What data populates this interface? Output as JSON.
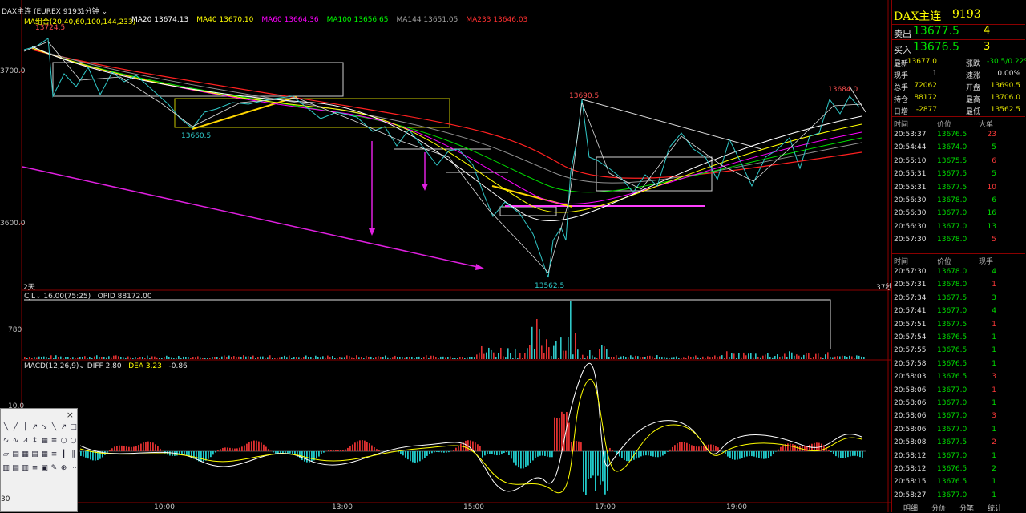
{
  "header": {
    "instrument": "DAX主连 (EUREX 9193)",
    "period": "1分钟",
    "ma_group": "MA组合(20,40,60,100,144,233)",
    "ma_values": [
      {
        "label": "MA20 13674.13",
        "color": "#ffffff"
      },
      {
        "label": "MA40 13670.10",
        "color": "#ffff00"
      },
      {
        "label": "MA60 13664.36",
        "color": "#ff00ff"
      },
      {
        "label": "MA100 13656.65",
        "color": "#00ff00"
      },
      {
        "label": "MA144 13651.05",
        "color": "#a0a0a0"
      },
      {
        "label": "MA233 13646.03",
        "color": "#ff3030"
      }
    ]
  },
  "price_axis": {
    "p13700": "3700.0",
    "p13600": "3600.0",
    "vol780": "780",
    "macd10": "10.0"
  },
  "annotations": {
    "high_start": "13724.5",
    "low1": "13660.5",
    "high_mid": "13690.5",
    "low_main": "13562.5",
    "high_end": "13684.0",
    "left_tag": "2天",
    "right_tag": "37秒"
  },
  "volume_header": {
    "name": "CJL",
    "value": "16.00(75:25)",
    "opid": "OPID 88172.00"
  },
  "macd_header": {
    "name": "MACD(12,26,9)",
    "diff": "DIFF 2.80",
    "dea": "DEA 3.23",
    "macd": "-0.86"
  },
  "time_axis": [
    "10:00",
    "13:00",
    "15:00",
    "17:00",
    "19:00"
  ],
  "quote": {
    "title": "DAX主连",
    "code": "9193",
    "sell_label": "卖出",
    "sell_price": "13677.5",
    "sell_vol": "4",
    "buy_label": "买入",
    "buy_price": "13676.5",
    "buy_vol": "3",
    "stats": [
      {
        "k1": "最新",
        "v1": "13677.0",
        "c1": "#e0e000",
        "k2": "涨跌",
        "v2": "-30.5/0.22%",
        "c2": "#00e000"
      },
      {
        "k1": "现手",
        "v1": "1",
        "c1": "#e0e0e0",
        "k2": "速涨",
        "v2": "0.00%",
        "c2": "#e0e0e0"
      },
      {
        "k1": "总手",
        "v1": "72062",
        "c1": "#e0e000",
        "k2": "开盘",
        "v2": "13690.5",
        "c2": "#e0e000"
      },
      {
        "k1": "持仓",
        "v1": "88172",
        "c1": "#e0e000",
        "k2": "最高",
        "v2": "13706.0",
        "c2": "#e0e000"
      },
      {
        "k1": "日增",
        "v1": "-2877",
        "c1": "#e0e000",
        "k2": "最低",
        "v2": "13562.5",
        "c2": "#e0e000"
      }
    ]
  },
  "ticks_big": {
    "headers": [
      "时间",
      "价位",
      "大单"
    ],
    "rows": [
      {
        "t": "20:53:37",
        "p": "13676.5",
        "v": "23",
        "vc": "#ff3a3a"
      },
      {
        "t": "20:54:44",
        "p": "13674.0",
        "v": "5",
        "vc": "#00e000"
      },
      {
        "t": "20:55:10",
        "p": "13675.5",
        "v": "6",
        "vc": "#ff3a3a"
      },
      {
        "t": "20:55:31",
        "p": "13677.5",
        "v": "5",
        "vc": "#00e000"
      },
      {
        "t": "20:55:31",
        "p": "13677.5",
        "v": "10",
        "vc": "#ff3a3a"
      },
      {
        "t": "20:56:30",
        "p": "13678.0",
        "v": "6",
        "vc": "#00e000"
      },
      {
        "t": "20:56:30",
        "p": "13677.0",
        "v": "16",
        "vc": "#00e000"
      },
      {
        "t": "20:56:30",
        "p": "13677.0",
        "v": "13",
        "vc": "#00e000"
      },
      {
        "t": "20:57:30",
        "p": "13678.0",
        "v": "5",
        "vc": "#ff3a3a"
      }
    ]
  },
  "ticks": {
    "headers": [
      "时间",
      "价位",
      "现手"
    ],
    "rows": [
      {
        "t": "20:57:30",
        "p": "13678.0",
        "v": "4",
        "vc": "#00e000"
      },
      {
        "t": "20:57:31",
        "p": "13678.0",
        "v": "1",
        "vc": "#ff3a3a"
      },
      {
        "t": "20:57:34",
        "p": "13677.5",
        "v": "3",
        "vc": "#00e000"
      },
      {
        "t": "20:57:41",
        "p": "13677.0",
        "v": "4",
        "vc": "#00e000"
      },
      {
        "t": "20:57:51",
        "p": "13677.5",
        "v": "1",
        "vc": "#ff3a3a"
      },
      {
        "t": "20:57:54",
        "p": "13676.5",
        "v": "1",
        "vc": "#00e000"
      },
      {
        "t": "20:57:55",
        "p": "13676.5",
        "v": "1",
        "vc": "#00e000"
      },
      {
        "t": "20:57:58",
        "p": "13676.5",
        "v": "1",
        "vc": "#00e000"
      },
      {
        "t": "20:58:03",
        "p": "13676.5",
        "v": "3",
        "vc": "#ff3a3a"
      },
      {
        "t": "20:58:06",
        "p": "13677.0",
        "v": "1",
        "vc": "#ff3a3a"
      },
      {
        "t": "20:58:06",
        "p": "13677.0",
        "v": "1",
        "vc": "#00e000"
      },
      {
        "t": "20:58:06",
        "p": "13677.0",
        "v": "3",
        "vc": "#ff3a3a"
      },
      {
        "t": "20:58:06",
        "p": "13677.0",
        "v": "1",
        "vc": "#00e000"
      },
      {
        "t": "20:58:08",
        "p": "13677.5",
        "v": "2",
        "vc": "#ff3a3a"
      },
      {
        "t": "20:58:12",
        "p": "13677.0",
        "v": "1",
        "vc": "#00e000"
      },
      {
        "t": "20:58:12",
        "p": "13676.5",
        "v": "2",
        "vc": "#00e000"
      },
      {
        "t": "20:58:15",
        "p": "13676.5",
        "v": "1",
        "vc": "#00e000"
      },
      {
        "t": "20:58:27",
        "p": "13677.0",
        "v": "1",
        "vc": "#00e000"
      }
    ]
  },
  "bottom_tabs": [
    "明细",
    "分价",
    "分笔",
    "统计"
  ],
  "toolbox": {
    "close": "×",
    "label_30": "30"
  }
}
